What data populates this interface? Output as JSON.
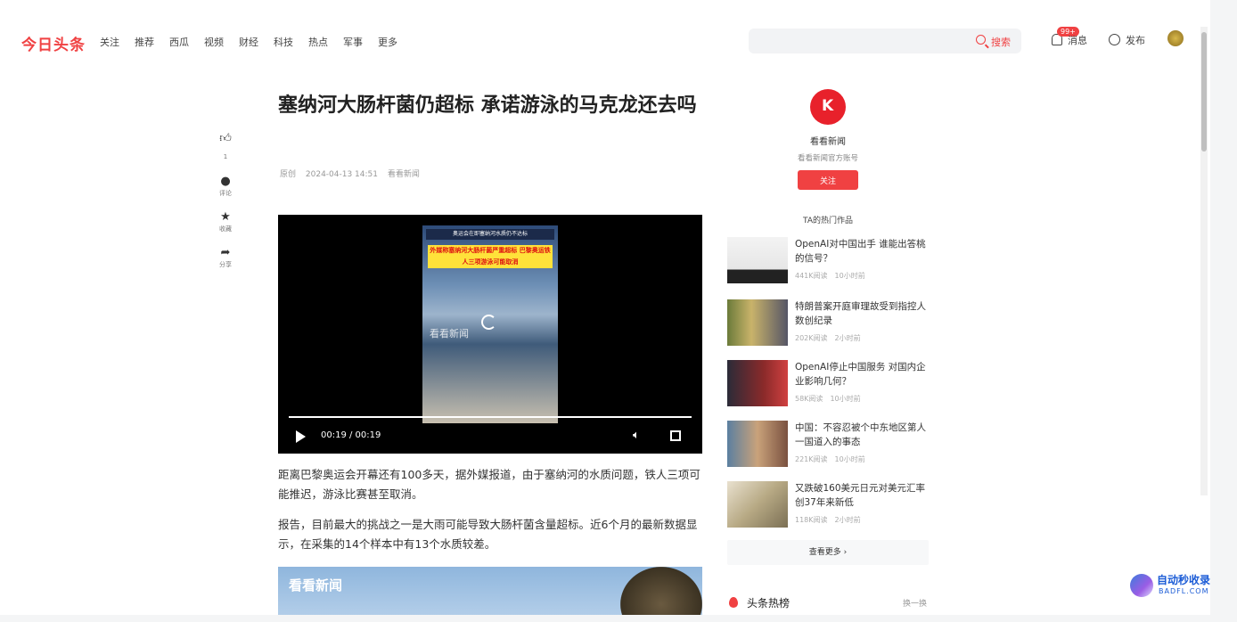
{
  "header": {
    "logo": "今日头条",
    "nav": [
      "关注",
      "推荐",
      "西瓜",
      "视频",
      "财经",
      "科技",
      "热点",
      "军事",
      "更多"
    ],
    "search_placeholder": "",
    "search_label": "搜索",
    "messages_label": "消息",
    "messages_badge": "99+",
    "publish_label": "发布"
  },
  "actions": {
    "like_count": "1",
    "comment_label": "评论",
    "collect_label": "收藏",
    "share_label": "分享"
  },
  "article": {
    "title": "塞纳河大肠杆菌仍超标 承诺游泳的马克龙还去吗",
    "source_type": "原创",
    "datetime": "2024-04-13 14:51",
    "author": "看看新闻",
    "video": {
      "caption_top": "奥运会在即塞纳河水质仍不达标",
      "caption_main": "外媒称塞纳河大肠杆菌严重超标 巴黎奥运铁人三项游泳可能取消",
      "watermark": "看看新闻",
      "time": "00:19 / 00:19"
    },
    "paragraphs": [
      "距离巴黎奥运会开幕还有100多天，据外媒报道，由于塞纳河的水质问题，铁人三项可能推迟，游泳比赛甚至取消。",
      "报告，目前最大的挑战之一是大雨可能导致大肠杆菌含量超标。近6个月的最新数据显示，在采集的14个样本中有13个水质较差。"
    ],
    "image_watermark": "看看新闻"
  },
  "sidebar": {
    "author_name": "看看新闻",
    "author_desc": "看看新闻官方账号",
    "follow_label": "关注",
    "hot_title": "TA的热门作品",
    "news": [
      {
        "title": "OpenAI对中国出手 谁能出答桃的信号？",
        "views": "441K阅读",
        "time": "10小时前"
      },
      {
        "title": "特朗普案开庭审理故受到指控人数创纪录",
        "views": "202K阅读",
        "time": "2小时前"
      },
      {
        "title": "OpenAI停止中国服务 对国内企业影响几何？",
        "views": "58K阅读",
        "time": "10小时前"
      },
      {
        "title": "中国：不容忍被个中东地区第人一国道入的事态",
        "views": "221K阅读",
        "time": "10小时前"
      },
      {
        "title": "又跌破160美元日元对美元汇率创37年来新低",
        "views": "118K阅读",
        "time": "2小时前"
      }
    ],
    "more_label": "查看更多",
    "toplist_title": "头条热榜",
    "swap_label": "换一换"
  },
  "site_watermark": {
    "name": "自动秒收录",
    "domain": "BADFL.COM"
  },
  "colors": {
    "brand": "#f04142",
    "text": "#222222"
  }
}
